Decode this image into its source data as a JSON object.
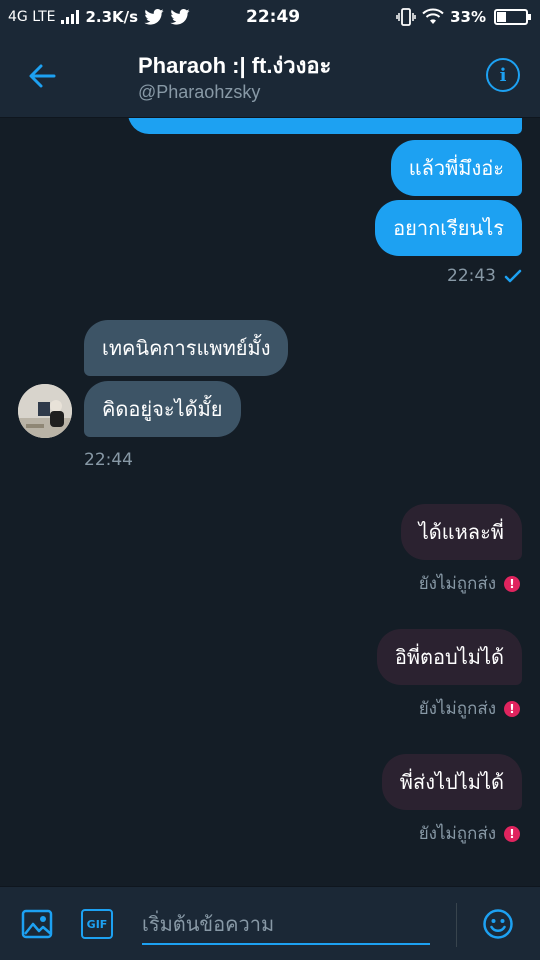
{
  "status_bar": {
    "network": "4G LTE",
    "speed": "2.3K/s",
    "time": "22:49",
    "battery": "33%",
    "battery_level": 0.33
  },
  "header": {
    "title": "Pharaoh :| ft.ง่วงอะ",
    "handle": "@Pharaohzsky",
    "back_icon": "arrow-left-icon",
    "info_icon": "info-icon",
    "info_glyph": "i"
  },
  "messages": {
    "sent_1": "แล้วพี่มึงอ่ะ",
    "sent_2": "อยากเรียนไร",
    "sent_time": "22:43",
    "recv_1": "เทคนิคการแพทย์มั้ง",
    "recv_2": "คิดอยู่จะได้มั้ย",
    "recv_time": "22:44",
    "failed_1": "ได้แหละพี่",
    "failed_2": "อิพี่ตอบไม่ได้",
    "failed_3": "พี่ส่งไปไม่ได้",
    "not_sent_label": "ยังไม่ถูกส่ง",
    "error_glyph": "!"
  },
  "composer": {
    "placeholder": "เริ่มต้นข้อความ",
    "gif_label": "GIF",
    "image_icon": "image-icon",
    "emoji_icon": "emoji-icon"
  },
  "colors": {
    "accent": "#1da1f2",
    "background": "#141d26",
    "header": "#1b2836",
    "received_bubble": "#3d5466",
    "failed_bubble": "#2b2230",
    "error": "#e0245e"
  }
}
